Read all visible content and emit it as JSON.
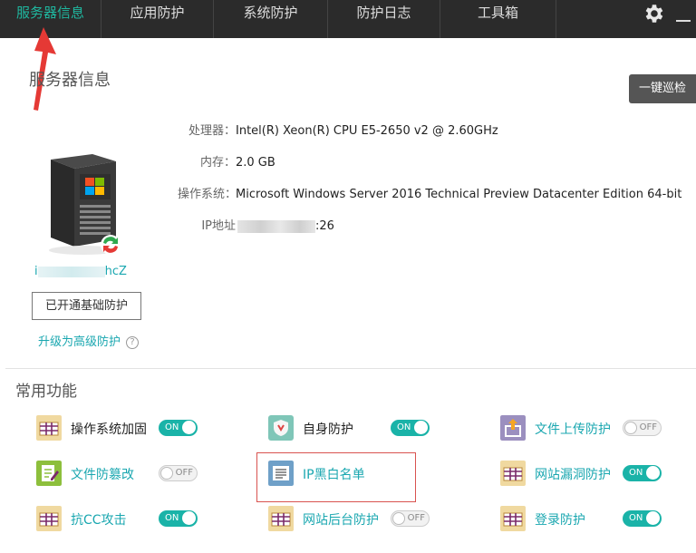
{
  "nav": {
    "tabs": [
      {
        "label": "服务器信息",
        "active": true
      },
      {
        "label": "应用防护",
        "active": false
      },
      {
        "label": "系统防护",
        "active": false
      },
      {
        "label": "防护日志",
        "active": false
      },
      {
        "label": "工具箱",
        "active": false
      }
    ]
  },
  "server_info": {
    "title": "服务器信息",
    "patrol_button": "一键巡检",
    "cpu_label": "处理器：",
    "cpu_value": "Intel(R) Xeon(R) CPU E5-2650 v2 @ 2.60GHz",
    "mem_label": "内存：",
    "mem_value": "2.0 GB",
    "os_label": "操作系统：",
    "os_value": "Microsoft Windows Server 2016 Technical Preview Datacenter Edition 64-bit",
    "ip_label": "IP地址",
    "ip_value_visible": ":26",
    "host_visible_prefix": "i",
    "host_visible_suffix": "hcZ",
    "basic_button": "已开通基础防护",
    "upgrade_link": "升级为高级防护",
    "help_symbol": "?"
  },
  "common": {
    "title": "常用功能",
    "features": [
      {
        "label": "操作系统加固",
        "toggle": "ON",
        "icon": "shield-grid-icon"
      },
      {
        "label": "自身防护",
        "toggle": "ON",
        "icon": "self-protect-icon"
      },
      {
        "label": "文件上传防护",
        "toggle": "OFF",
        "icon": "upload-icon"
      },
      {
        "label": "文件防篡改",
        "toggle": "OFF",
        "icon": "file-edit-icon"
      },
      {
        "label": "IP黑白名单",
        "toggle": "",
        "icon": "ip-list-icon"
      },
      {
        "label": "网站漏洞防护",
        "toggle": "ON",
        "icon": "firewall-icon"
      },
      {
        "label": "抗CC攻击",
        "toggle": "ON",
        "icon": "firewall-icon"
      },
      {
        "label": "网站后台防护",
        "toggle": "OFF",
        "icon": "firewall-icon"
      },
      {
        "label": "登录防护",
        "toggle": "ON",
        "icon": "firewall-icon"
      }
    ]
  },
  "colors": {
    "accent": "#1fb8a0",
    "nav_bg": "#2b2b2b",
    "highlight": "#d9534f",
    "arrow": "#e53935"
  }
}
